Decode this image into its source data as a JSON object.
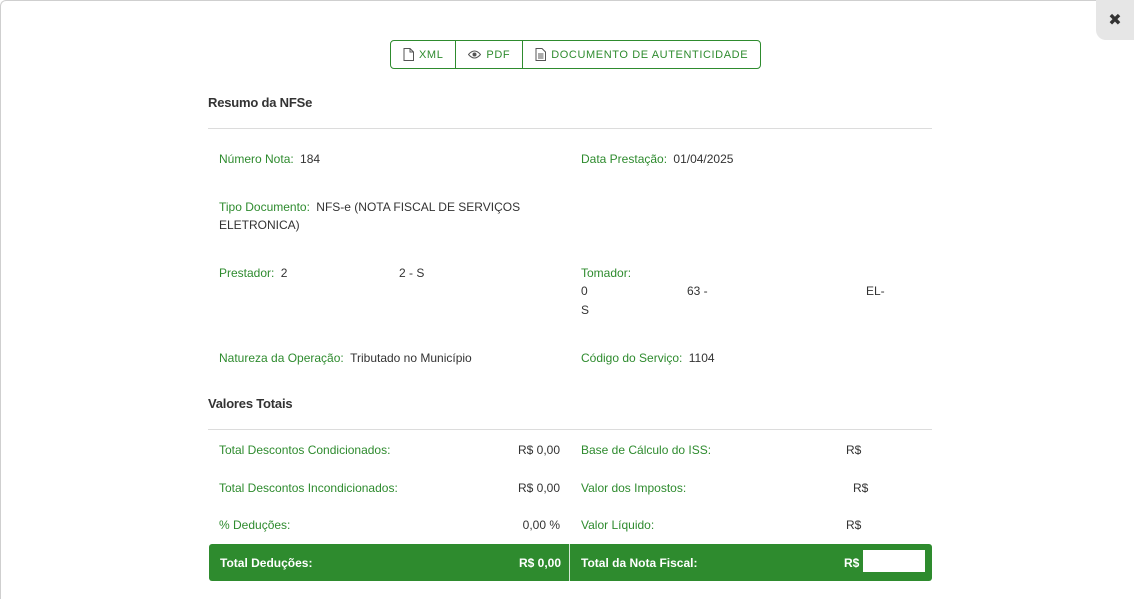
{
  "close_icon_glyph": "✖",
  "toolbar": {
    "xml_label": "XML",
    "pdf_label": "PDF",
    "doc_label": "DOCUMENTO DE AUTENTICIDADE"
  },
  "resumo": {
    "title": "Resumo da NFSe",
    "numero_nota_label": "Número Nota:",
    "numero_nota_value": "184",
    "data_prestacao_label": "Data Prestação:",
    "data_prestacao_value": "01/04/2025",
    "tipo_documento_label": "Tipo Documento:",
    "tipo_documento_value_1": "NFS-e (NOTA FISCAL DE SERVIÇOS",
    "tipo_documento_value_2": "ELETRONICA)",
    "prestador_label": "Prestador:",
    "prestador_value_a": "2",
    "prestador_value_b": "2 - S",
    "tomador_label": "Tomador:",
    "tomador_value_a": "0",
    "tomador_value_b": "63 -",
    "tomador_value_c": "EL-",
    "tomador_value_d": "S",
    "natureza_label": "Natureza da Operação:",
    "natureza_value": "Tributado no Município",
    "codigo_servico_label": "Código do Serviço:",
    "codigo_servico_value": "1104"
  },
  "valores": {
    "title": "Valores Totais",
    "rows": [
      {
        "left_label": "Total Descontos Condicionados:",
        "left_value": "R$ 0,00",
        "right_label": "Base de Cálculo do ISS:",
        "right_value": "R$"
      },
      {
        "left_label": "Total Descontos Incondicionados:",
        "left_value": "R$ 0,00",
        "right_label": "Valor dos Impostos:",
        "right_value": "R$"
      },
      {
        "left_label": "% Deduções:",
        "left_value": "0,00 %",
        "right_label": "Valor Líquido:",
        "right_value": "R$"
      }
    ],
    "total_deducoes_label": "Total Deduções:",
    "total_deducoes_value": "R$ 0,00",
    "total_nota_label": "Total da Nota Fiscal:",
    "total_nota_value": "R$"
  },
  "colors": {
    "accent": "#2e8b2e",
    "text": "#333333",
    "divider": "#dcdcdc"
  },
  "icons": {
    "xml": "file-icon",
    "pdf": "eye-icon",
    "doc": "document-text-icon",
    "close": "close-icon"
  }
}
